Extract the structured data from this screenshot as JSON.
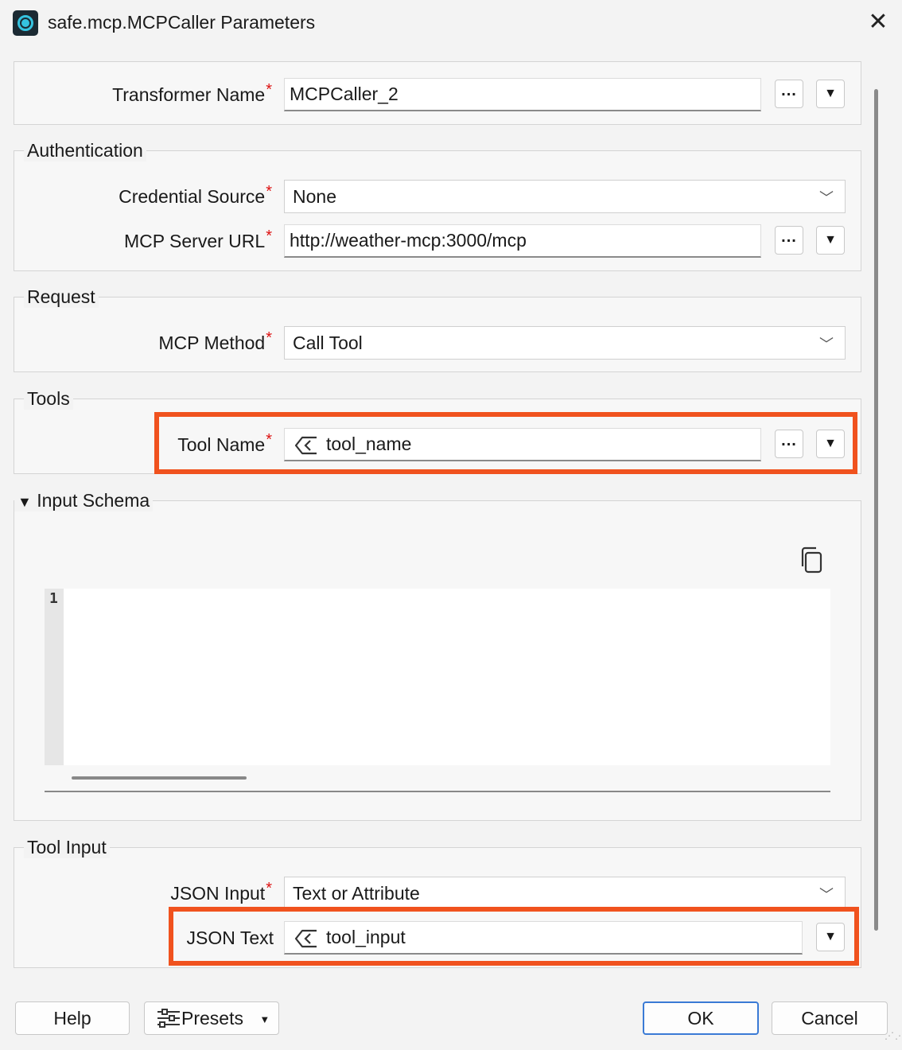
{
  "window": {
    "title": "safe.mcp.MCPCaller Parameters",
    "close_glyph": "✕"
  },
  "transformer": {
    "label": "Transformer Name",
    "value": "MCPCaller_2"
  },
  "authentication": {
    "title": "Authentication",
    "credential_source": {
      "label": "Credential Source",
      "value": "None"
    },
    "server_url": {
      "label": "MCP Server URL",
      "value": "http://weather-mcp:3000/mcp"
    }
  },
  "request": {
    "title": "Request",
    "method": {
      "label": "MCP Method",
      "value": "Call Tool"
    }
  },
  "tools": {
    "title": "Tools",
    "tool_name": {
      "label": "Tool Name",
      "value": "tool_name"
    }
  },
  "input_schema": {
    "title": "Input Schema",
    "expanded": true,
    "line_number": "1",
    "content": ""
  },
  "tool_input": {
    "title": "Tool Input",
    "json_input": {
      "label": "JSON Input",
      "value": "Text or Attribute"
    },
    "json_text": {
      "label": "JSON Text",
      "value": "tool_input"
    }
  },
  "buttons": {
    "ellipsis": "...",
    "dropdown": "▼",
    "help": "Help",
    "presets": "Presets",
    "ok": "OK",
    "cancel": "Cancel"
  },
  "required_marker": "*",
  "colors": {
    "highlight": "#f0521e",
    "accent": "#35c3e0",
    "ok_border": "#3a7ad5"
  }
}
